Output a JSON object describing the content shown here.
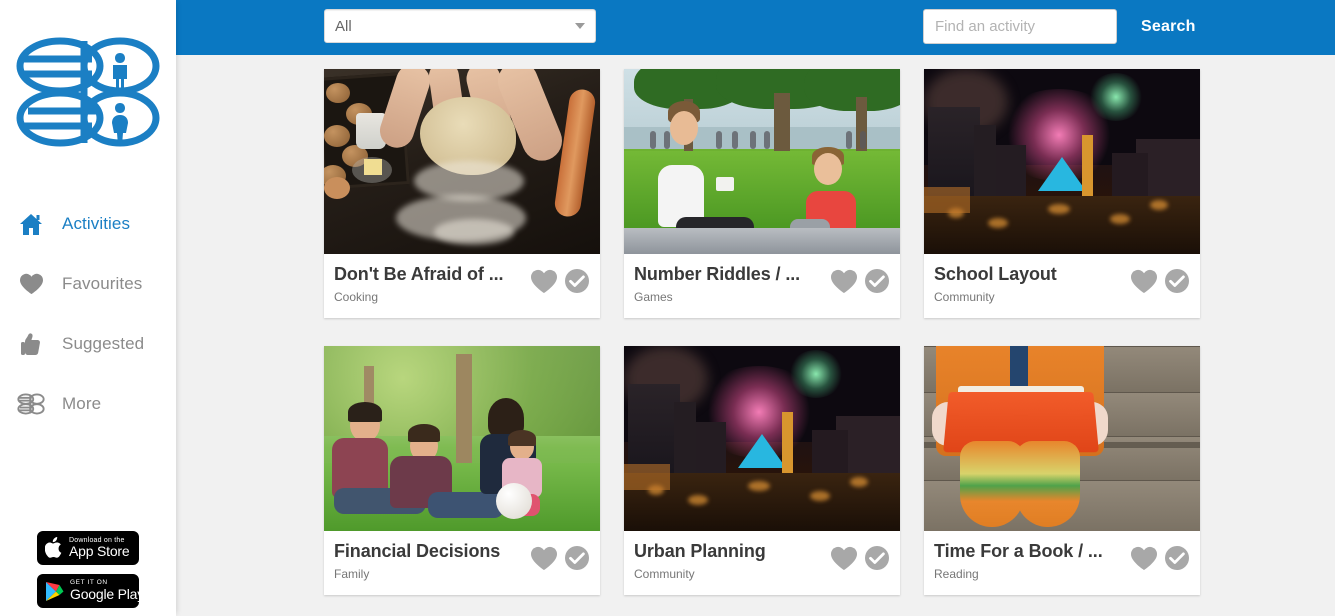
{
  "brand": {
    "logo_alt": "brand-logo",
    "primary_color": "#0a78c2",
    "muted_color": "#8b8b8b"
  },
  "sidebar": {
    "items": [
      {
        "label": "Activities",
        "icon": "home-icon",
        "active": true
      },
      {
        "label": "Favourites",
        "icon": "heart-icon",
        "active": false
      },
      {
        "label": "Suggested",
        "icon": "thumbs-up-icon",
        "active": false
      },
      {
        "label": "More",
        "icon": "grid-logo-icon",
        "active": false
      }
    ],
    "badges": [
      {
        "id": "app-store",
        "top": "Download on the",
        "bottom": "App Store",
        "icon": "apple-icon"
      },
      {
        "id": "google-play",
        "top": "GET IT ON",
        "bottom": "Google Play",
        "icon": "google-play-icon"
      }
    ]
  },
  "topbar": {
    "filter": {
      "selected": "All",
      "options": [
        "All"
      ],
      "caret_icon": "chevron-down-icon"
    },
    "search": {
      "value": "",
      "placeholder": "Find an activity",
      "button_label": "Search"
    }
  },
  "cards": [
    {
      "title": "Don't Be Afraid of ...",
      "category": "Cooking",
      "scene": "baking",
      "favourite_icon": "heart-icon",
      "done_icon": "check-circle-icon"
    },
    {
      "title": "Number Riddles / ...",
      "category": "Games",
      "scene": "park",
      "favourite_icon": "heart-icon",
      "done_icon": "check-circle-icon"
    },
    {
      "title": "School Layout",
      "category": "Community",
      "scene": "fireworks",
      "favourite_icon": "heart-icon",
      "done_icon": "check-circle-icon"
    },
    {
      "title": "Financial Decisions",
      "category": "Family",
      "scene": "family",
      "favourite_icon": "heart-icon",
      "done_icon": "check-circle-icon"
    },
    {
      "title": "Urban Planning",
      "category": "Community",
      "scene": "fireworks",
      "favourite_icon": "heart-icon",
      "done_icon": "check-circle-icon"
    },
    {
      "title": "Time For a Book / ...",
      "category": "Reading",
      "scene": "book",
      "favourite_icon": "heart-icon",
      "done_icon": "check-circle-icon"
    }
  ]
}
